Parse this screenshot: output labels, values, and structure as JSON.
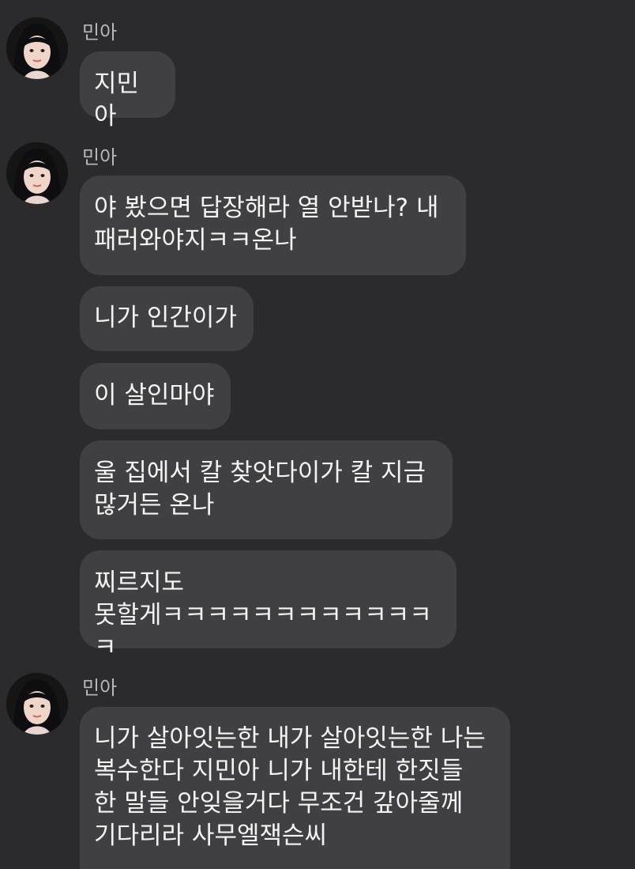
{
  "groups": [
    {
      "sender": "민아",
      "messages": [
        "지민아"
      ]
    },
    {
      "sender": "민아",
      "messages": [
        "야 봤으면 답장해라 열 안받나? 내\n패러와야지ㅋㅋ온나",
        "니가 인간이가",
        "이 살인마야",
        "울 집에서 칼 찾앗다이가 칼 지금\n많거든 온나",
        "찌르지도\n못할게ㅋㅋㅋㅋㅋㅋㅋㅋㅋㅋㅋㅋㅋ"
      ]
    },
    {
      "sender": "민아",
      "messages": [
        "니가 살아잇는한 내가 살아잇는한 나는\n복수한다 지민아 니가 내한테 한짓들\n한 말들 안잊을거다 무조건 갚아줄께\n기다리라 사무엘잭슨씨"
      ]
    }
  ],
  "colors": {
    "background": "#2b2b2d",
    "bubble": "#404042",
    "sender": "#b9b9bb",
    "text": "#f4f4f4"
  },
  "icons": {
    "avatar": "profile-photo"
  }
}
